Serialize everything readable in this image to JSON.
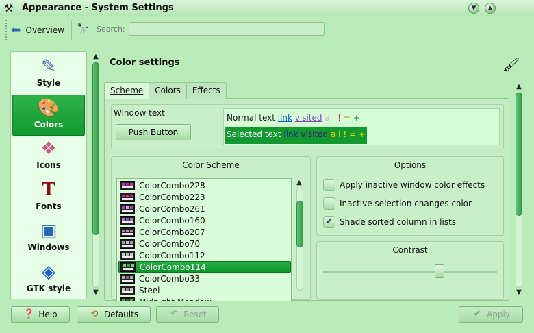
{
  "window": {
    "title": "Appearance - System Settings",
    "icons": {
      "app": "tools-icon",
      "minimize": "chevron-down-icon",
      "maximize": "chevron-up-icon"
    }
  },
  "toolbar": {
    "overview_label": "Overview",
    "search_label": "Search:",
    "search_value": "",
    "search_placeholder": ""
  },
  "sidebar": {
    "items": [
      {
        "label": "Style",
        "icon": "style-icon",
        "selected": false
      },
      {
        "label": "Colors",
        "icon": "colors-icon",
        "selected": true
      },
      {
        "label": "Icons",
        "icon": "icons-icon",
        "selected": false
      },
      {
        "label": "Fonts",
        "icon": "fonts-icon",
        "selected": false
      },
      {
        "label": "Windows",
        "icon": "windows-icon",
        "selected": false
      },
      {
        "label": "GTK style",
        "icon": "gtk-icon",
        "selected": false
      }
    ]
  },
  "main": {
    "title": "Color settings",
    "tabs": [
      {
        "label": "Scheme",
        "active": true
      },
      {
        "label": "Colors",
        "active": false
      },
      {
        "label": "Effects",
        "active": false
      }
    ],
    "preview": {
      "window_text": "Window text",
      "push_button": "Push Button",
      "normal": {
        "text": "Normal text",
        "link": "link",
        "visited": "visited",
        "active": "a",
        "negative": "!",
        "neutral": "=",
        "positive": "+"
      },
      "selected": {
        "text": "Selected text",
        "link": "link",
        "visited": "visited",
        "active": "a",
        "inactive": "i",
        "negative": "!",
        "neutral": "=",
        "positive": "+"
      }
    },
    "color_scheme": {
      "title": "Color Scheme",
      "items": [
        "ColorCombo228",
        "ColorCombo223",
        "ColorCombo261",
        "ColorCombo160",
        "ColorCombo207",
        "ColorCombo70",
        "ColorCombo112",
        "ColorCombo114",
        "ColorCombo33",
        "Steel",
        "Midnight Meadow"
      ],
      "selected_index": 7
    },
    "options": {
      "title": "Options",
      "items": [
        {
          "label": "Apply inactive window color effects",
          "checked": false
        },
        {
          "label": "Inactive selection changes color",
          "checked": false
        },
        {
          "label": "Shade sorted column in lists",
          "checked": true
        }
      ]
    },
    "contrast": {
      "title": "Contrast",
      "value": 0.68
    }
  },
  "buttons": {
    "help": "Help",
    "defaults": "Defaults",
    "reset": "Reset",
    "apply": "Apply"
  },
  "colors": {
    "accent": "#139930",
    "background": "#b9ecb9",
    "panel": "#d8fbd8"
  }
}
